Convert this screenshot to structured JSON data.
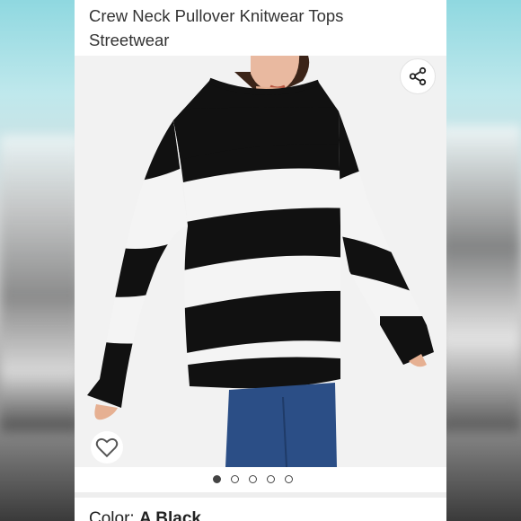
{
  "product": {
    "title_line1": "Crew Neck Pullover Knitwear Tops",
    "title_line2": "Streetwear",
    "color_label": "Color:",
    "color_value": "A Black"
  },
  "gallery": {
    "image_count": 5,
    "active_index": 0
  },
  "icons": {
    "share": "share-icon",
    "wishlist": "heart-icon"
  },
  "colors": {
    "stripe_dark": "#111111",
    "stripe_light": "#f4f4f4",
    "jeans": "#2b4e86",
    "image_bg": "#f2f2f2"
  }
}
